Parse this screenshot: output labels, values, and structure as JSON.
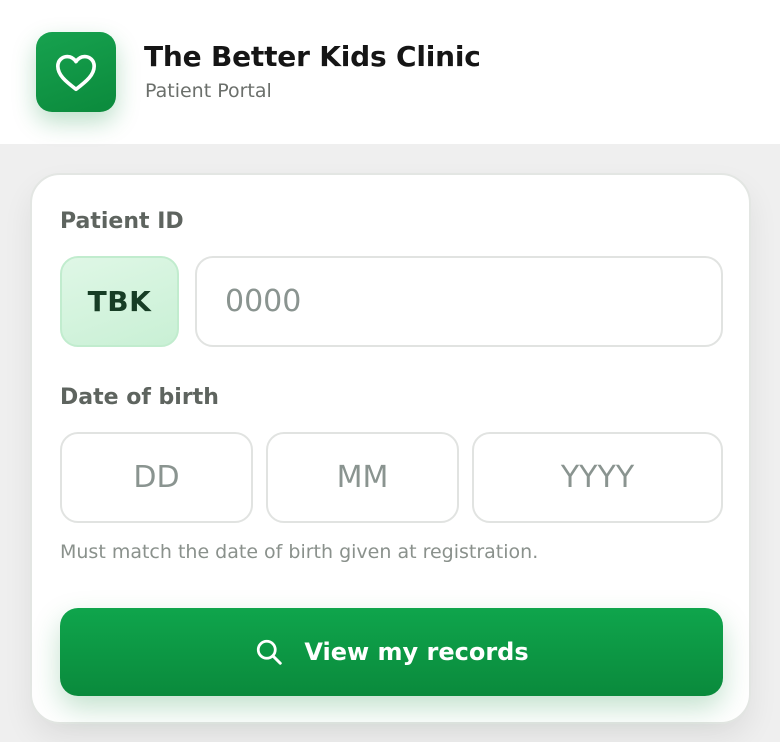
{
  "header": {
    "logo_icon": "heart-icon",
    "title": "The Better Kids Clinic",
    "subtitle": "Patient Portal"
  },
  "form": {
    "patient_id": {
      "label": "Patient ID",
      "prefix": "TBK",
      "placeholder": "0000",
      "value": ""
    },
    "dob": {
      "label": "Date of birth",
      "day_placeholder": "DD",
      "month_placeholder": "MM",
      "year_placeholder": "YYYY",
      "hint": "Must match the date of birth given at registration."
    },
    "submit": {
      "icon": "search-icon",
      "label": "View my records"
    }
  },
  "colors": {
    "brand_green": "#0f9a47",
    "prefix_bg": "#d6f5df",
    "prefix_text": "#173d25"
  }
}
